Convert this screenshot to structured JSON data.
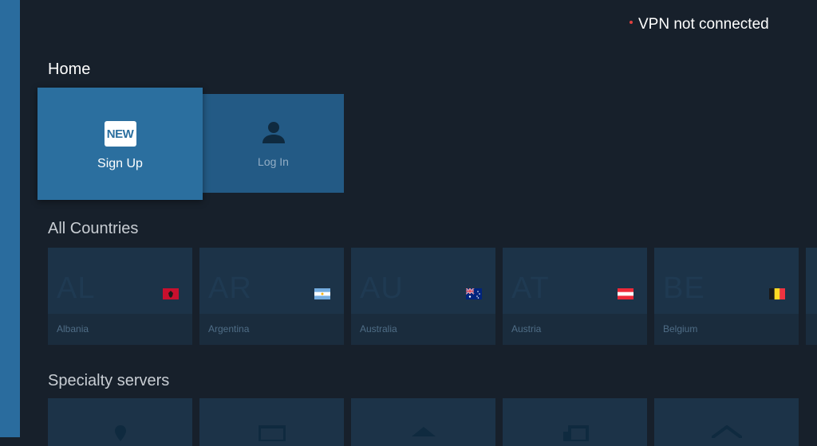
{
  "status": {
    "vpn_text": "VPN not connected",
    "dot_color": "#e0403f"
  },
  "home": {
    "title": "Home",
    "signup": {
      "badge": "NEW",
      "label": "Sign Up"
    },
    "login": {
      "label": "Log In"
    }
  },
  "countries": {
    "title": "All Countries",
    "items": [
      {
        "code": "AL",
        "name": "Albania",
        "flag": "albania-flag-icon"
      },
      {
        "code": "AR",
        "name": "Argentina",
        "flag": "argentina-flag-icon"
      },
      {
        "code": "AU",
        "name": "Australia",
        "flag": "australia-flag-icon"
      },
      {
        "code": "AT",
        "name": "Austria",
        "flag": "austria-flag-icon"
      },
      {
        "code": "BE",
        "name": "Belgium",
        "flag": "belgium-flag-icon"
      }
    ]
  },
  "specialty": {
    "title": "Specialty servers",
    "icons": [
      "location-pin-icon",
      "server-box-icon",
      "home-icon",
      "streaming-icon",
      "house-roof-icon"
    ]
  },
  "colors": {
    "background": "#17202b",
    "accent": "#2b6f9f",
    "card": "#1c3348"
  }
}
